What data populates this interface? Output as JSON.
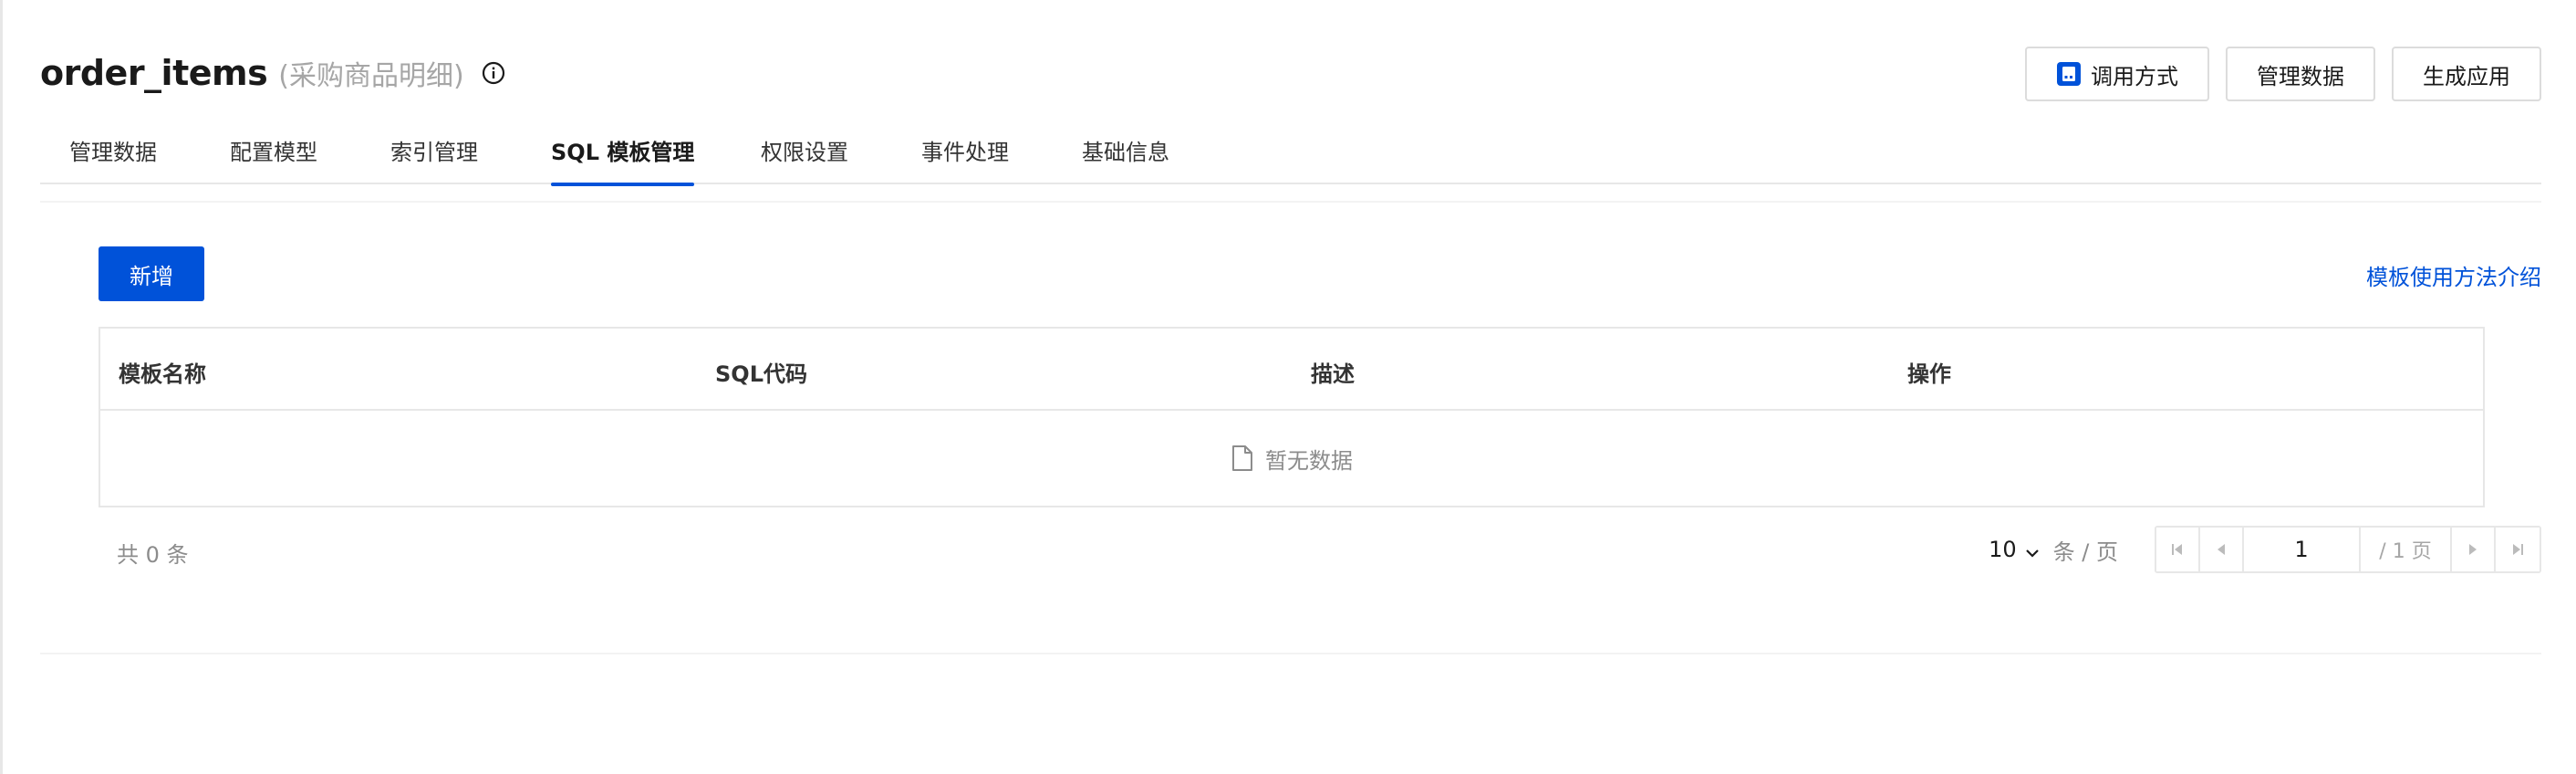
{
  "header": {
    "title": "order_items",
    "subtitle": "(采购商品明细)",
    "actions": {
      "call_method": "调用方式",
      "manage_data": "管理数据",
      "generate_app": "生成应用"
    }
  },
  "tabs": [
    {
      "label": "管理数据"
    },
    {
      "label": "配置模型"
    },
    {
      "label": "索引管理"
    },
    {
      "label": "SQL 模板管理",
      "active": true
    },
    {
      "label": "权限设置"
    },
    {
      "label": "事件处理"
    },
    {
      "label": "基础信息"
    }
  ],
  "toolbar": {
    "add_label": "新增",
    "intro_link": "模板使用方法介绍"
  },
  "table": {
    "columns": [
      "模板名称",
      "SQL代码",
      "描述",
      "操作"
    ],
    "rows": [],
    "empty_text": "暂无数据"
  },
  "pagination": {
    "total_text": "共 0 条",
    "page_size": "10",
    "per_page_text": "条 / 页",
    "current_page": "1",
    "total_pages_text": "/ 1 页"
  },
  "colors": {
    "primary": "#0052d9",
    "border": "#e7e7e7",
    "muted_text": "#8c8c8c"
  }
}
